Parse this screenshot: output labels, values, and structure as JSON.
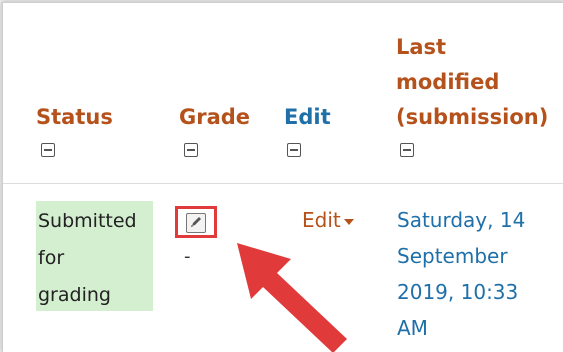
{
  "columns": {
    "status": {
      "label": "Status"
    },
    "grade": {
      "label": "Grade"
    },
    "edit": {
      "label": "Edit"
    },
    "last_modified": {
      "label": "Last\nmodified\n(submission)"
    }
  },
  "row": {
    "status": "Submitted\nfor\ngrading",
    "grade_value": "-",
    "edit_menu_label": "Edit",
    "last_modified": "Saturday, 14\nSeptember\n2019, 10:33\nAM"
  },
  "colors": {
    "header_orange": "#b5521c",
    "header_blue": "#1f6fa8",
    "status_bg": "#d4efd0",
    "highlight_red": "#e03a3a"
  },
  "icons": {
    "collapse": "collapse-column-icon",
    "grade": "grade-edit-icon",
    "caret": "caret-down-icon",
    "pointer": "red-arrow"
  }
}
